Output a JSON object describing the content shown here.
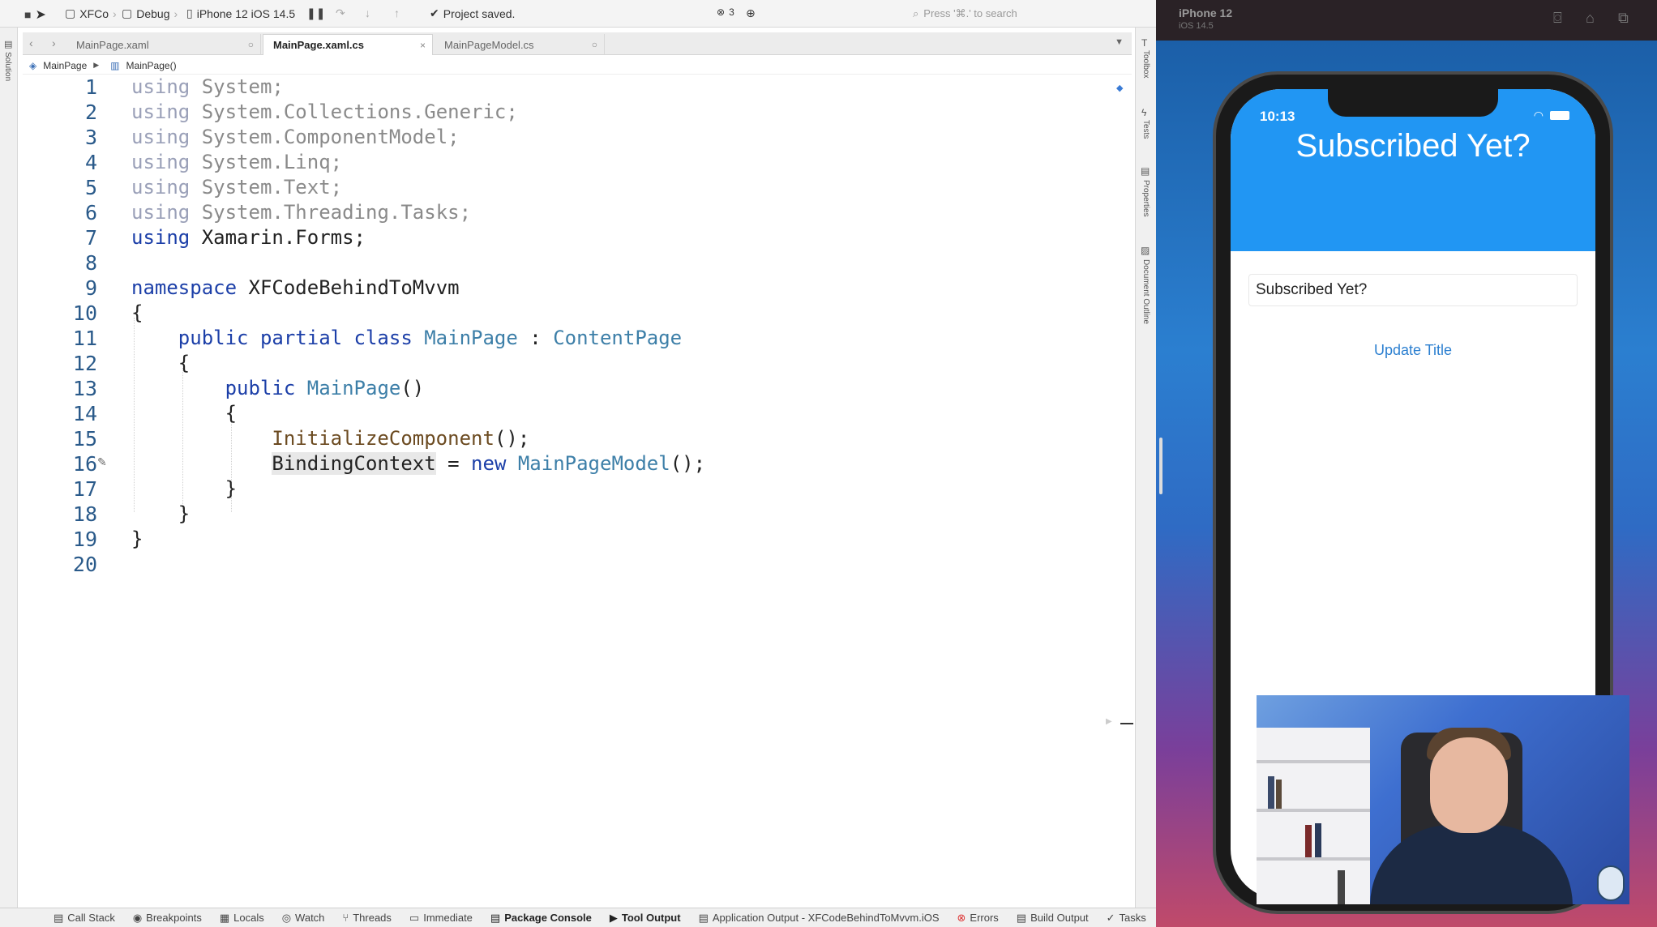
{
  "toolbar": {
    "project": "XFCo",
    "config": "Debug",
    "device": "iPhone 12 iOS 14.5",
    "status": "Project saved.",
    "error_count": "3",
    "search_placeholder": "Press '⌘.' to search"
  },
  "tabs": [
    {
      "label": "MainPage.xaml"
    },
    {
      "label": "MainPage.xaml.cs"
    },
    {
      "label": "MainPageModel.cs"
    }
  ],
  "breadcrumb": {
    "class": "MainPage",
    "member": "MainPage()"
  },
  "left_strip": {
    "solution": "Solution"
  },
  "right_strip": {
    "toolbox": "Toolbox",
    "tests": "Tests",
    "properties": "Properties",
    "outline": "Document Outline"
  },
  "code": {
    "line_numbers": [
      "1",
      "2",
      "3",
      "4",
      "5",
      "6",
      "7",
      "8",
      "9",
      "10",
      "11",
      "12",
      "13",
      "14",
      "15",
      "16",
      "17",
      "18",
      "19",
      "20"
    ],
    "using_kw": "using",
    "l1": "System;",
    "l2": "System.Collections.Generic;",
    "l3": "System.ComponentModel;",
    "l4": "System.Linq;",
    "l5": "System.Text;",
    "l6": "System.Threading.Tasks;",
    "l7": "Xamarin.Forms;",
    "namespace_kw": "namespace",
    "namespace_name": "XFCodeBehindToMvvm",
    "open_brace": "{",
    "close_brace": "}",
    "class_mods": "public partial class",
    "class_name": "MainPage",
    "colon": ":",
    "base_class": "ContentPage",
    "public_kw": "public",
    "ctor_name": "MainPage",
    "ctor_parens": "()",
    "init_call": "InitializeComponent",
    "init_tail": "();",
    "binding_ctx": "BindingContext",
    "assign": "=",
    "new_kw": "new",
    "model_type": "MainPageModel",
    "model_tail": "();"
  },
  "statusbar": {
    "call_stack": "Call Stack",
    "breakpoints": "Breakpoints",
    "locals": "Locals",
    "watch": "Watch",
    "threads": "Threads",
    "immediate": "Immediate",
    "package_console": "Package Console",
    "tool_output": "Tool Output",
    "app_output": "Application Output - XFCodeBehindToMvvm.iOS",
    "errors": "Errors",
    "build_output": "Build Output",
    "tasks": "Tasks"
  },
  "simulator": {
    "device": "iPhone 12",
    "os": "iOS 14.5",
    "time": "10:13",
    "app_title": "Subscribed Yet?",
    "entry_value": "Subscribed Yet?",
    "button_label": "Update Title"
  },
  "colors": {
    "keyword": "#1c3fa8",
    "type": "#3d7fa8",
    "app_header": "#2196f3"
  }
}
